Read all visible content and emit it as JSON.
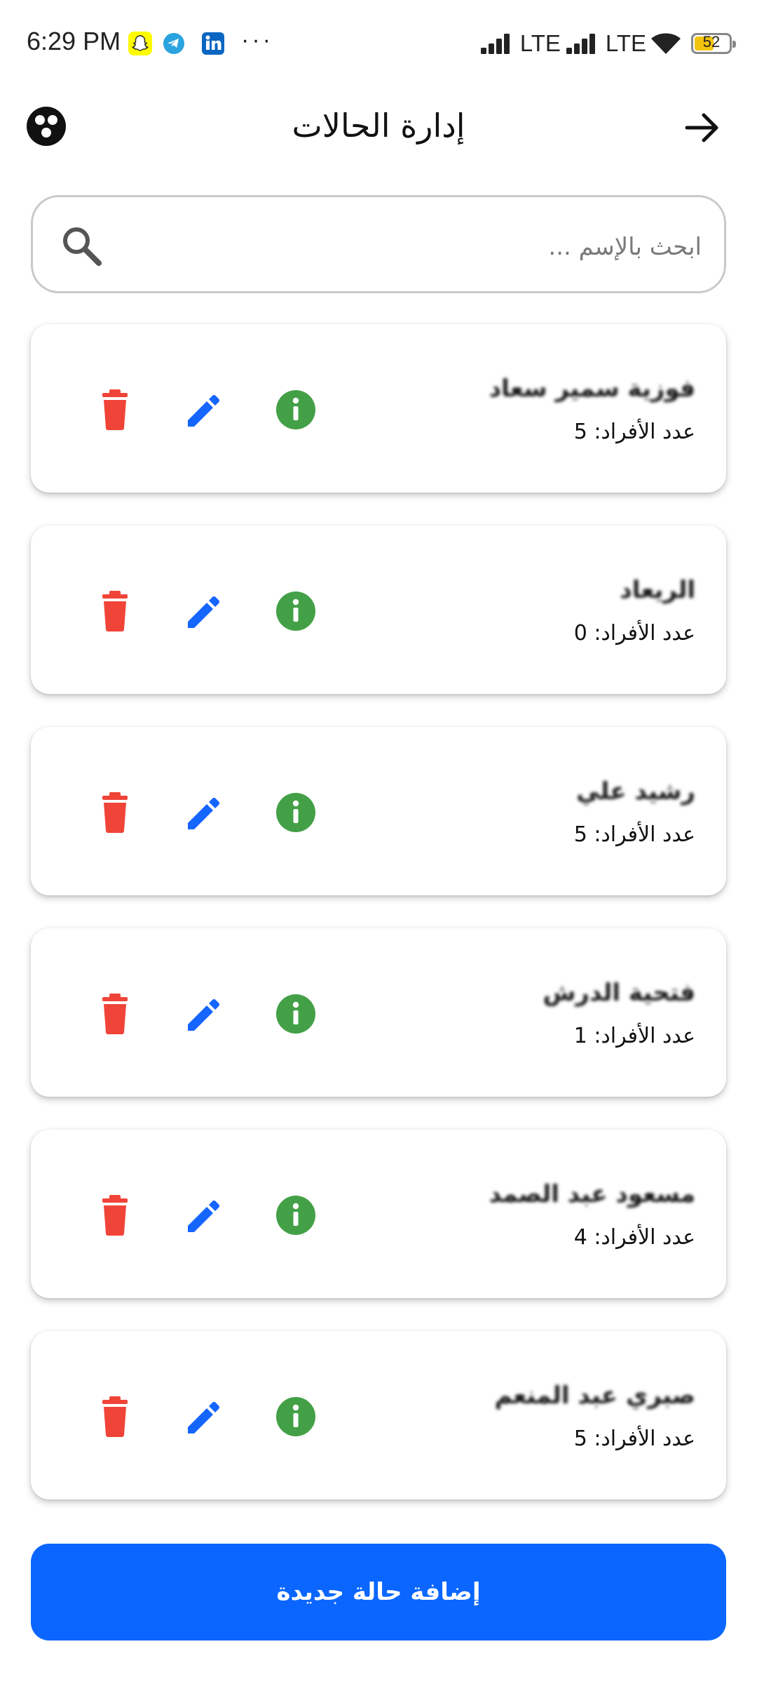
{
  "status_bar": {
    "time": "6:29 PM",
    "more": "···",
    "network_1": "LTE",
    "network_2": "LTE",
    "battery": "52",
    "icons": [
      "snapchat-icon",
      "telegram-icon",
      "linkedin-icon",
      "signal-icon",
      "wifi-icon",
      "battery-icon"
    ]
  },
  "app_bar": {
    "title": "إدارة الحالات",
    "logo_icon": "logo-icon",
    "back_icon": "arrow-right-icon"
  },
  "search": {
    "placeholder": "ابحث بالإسم ...",
    "value": ""
  },
  "cases": [
    {
      "name": "فوزية سمير سعاد",
      "count_label": "عدد الأفراد: 5"
    },
    {
      "name": "الريعاد",
      "count_label": "عدد الأفراد: 0"
    },
    {
      "name": "رشيد علي",
      "count_label": "عدد الأفراد: 5"
    },
    {
      "name": "فتحية الدرش",
      "count_label": "عدد الأفراد: 1"
    },
    {
      "name": "مسعود عبد الصمد",
      "count_label": "عدد الأفراد: 4"
    },
    {
      "name": "صبري عبد المنعم",
      "count_label": "عدد الأفراد: 5"
    }
  ],
  "actions": {
    "delete_icon": "trash-icon",
    "edit_icon": "pencil-icon",
    "info_icon": "info-icon"
  },
  "add_button": {
    "label": "إضافة حالة جديدة"
  },
  "colors": {
    "primary": "#0a66ff",
    "delete": "#f04438",
    "edit": "#1565ff",
    "info": "#43a047"
  }
}
